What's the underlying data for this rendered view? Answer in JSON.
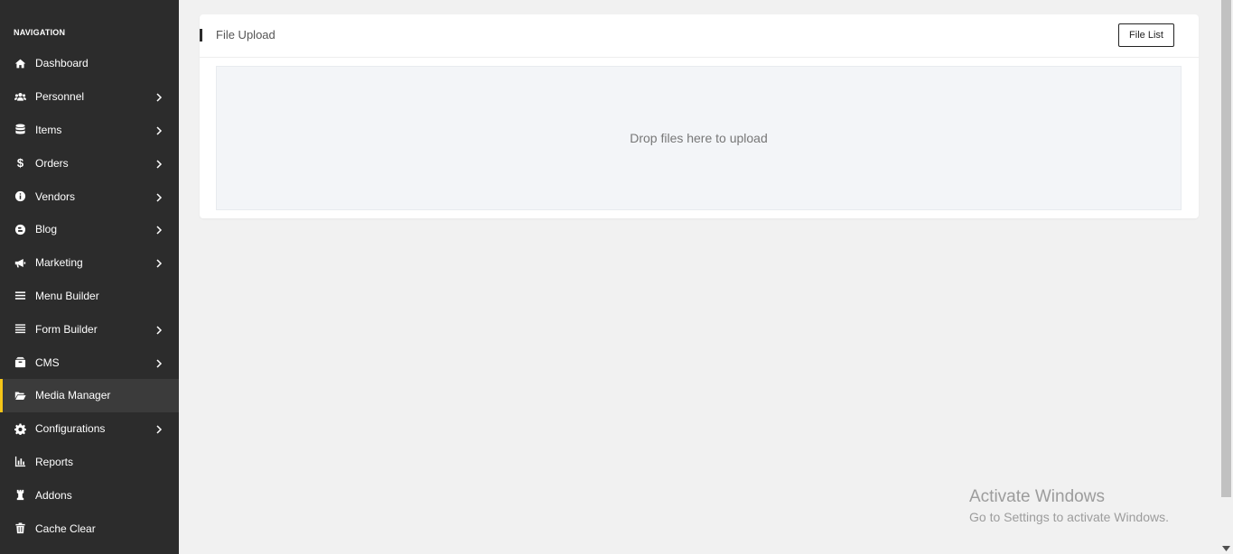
{
  "sidebar": {
    "heading": "NAVIGATION",
    "items": [
      {
        "label": "Dashboard",
        "icon": "home-icon",
        "has_submenu": false
      },
      {
        "label": "Personnel",
        "icon": "users-icon",
        "has_submenu": true
      },
      {
        "label": "Items",
        "icon": "database-icon",
        "has_submenu": true
      },
      {
        "label": "Orders",
        "icon": "dollar-icon",
        "has_submenu": true
      },
      {
        "label": "Vendors",
        "icon": "info-circle-icon",
        "has_submenu": true
      },
      {
        "label": "Blog",
        "icon": "blogger-icon",
        "has_submenu": true
      },
      {
        "label": "Marketing",
        "icon": "megaphone-icon",
        "has_submenu": true
      },
      {
        "label": "Menu Builder",
        "icon": "bars-icon",
        "has_submenu": false
      },
      {
        "label": "Form Builder",
        "icon": "list-icon",
        "has_submenu": true
      },
      {
        "label": "CMS",
        "icon": "box-icon",
        "has_submenu": true
      },
      {
        "label": "Media Manager",
        "icon": "folder-open-icon",
        "has_submenu": false,
        "active": true
      },
      {
        "label": "Configurations",
        "icon": "gear-icon",
        "has_submenu": true
      },
      {
        "label": "Reports",
        "icon": "bar-chart-icon",
        "has_submenu": false
      },
      {
        "label": "Addons",
        "icon": "chess-rook-icon",
        "has_submenu": false
      },
      {
        "label": "Cache Clear",
        "icon": "trash-icon",
        "has_submenu": false
      }
    ],
    "active_accent": "#f5c518"
  },
  "main": {
    "card": {
      "title": "File Upload",
      "file_list_button": "File List",
      "dropzone_text": "Drop files here to upload"
    }
  },
  "watermark": {
    "title": "Activate Windows",
    "subtitle": "Go to Settings to activate Windows."
  }
}
